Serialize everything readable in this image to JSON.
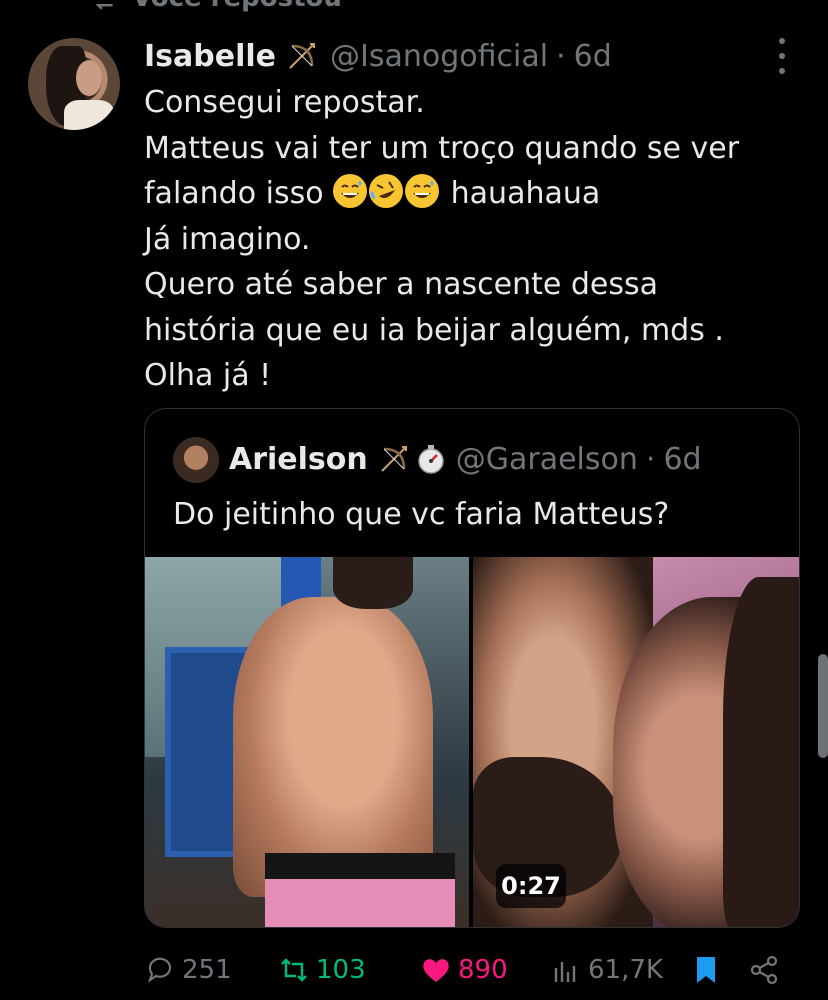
{
  "repost_bar": {
    "label": "Você repostou"
  },
  "tweet": {
    "author_name": "Isabelle",
    "handle": "@Isanogoficial",
    "separator": "·",
    "time": "6d",
    "lines": {
      "l1": "Consegui repostar.",
      "l2": "Matteus vai ter um troço quando se ver",
      "l3a": "falando isso",
      "l3b": "hauahaua",
      "l4": "Já imagino.",
      "l5": "Quero até saber a nascente dessa",
      "l6": "história que eu ia beijar alguém, mds .",
      "l7": "Olha já !"
    },
    "emojis": [
      "grinning-sweat-emoji",
      "rolling-laughing-emoji",
      "grinning-sweat-emoji"
    ]
  },
  "quote": {
    "author_name": "Arielson",
    "handle": "@Garaelson",
    "separator": "·",
    "time": "6d",
    "text": "Do jeitinho que vc faria Matteus?",
    "video_duration": "0:27"
  },
  "actions": {
    "replies": "251",
    "reposts": "103",
    "likes": "890",
    "views": "61,7K"
  },
  "colors": {
    "background": "#000000",
    "text": "#e7e9ea",
    "muted": "#71767b",
    "repost_green": "#00ba7c",
    "like_pink": "#f91880",
    "bookmark_blue": "#1d9bf0"
  }
}
